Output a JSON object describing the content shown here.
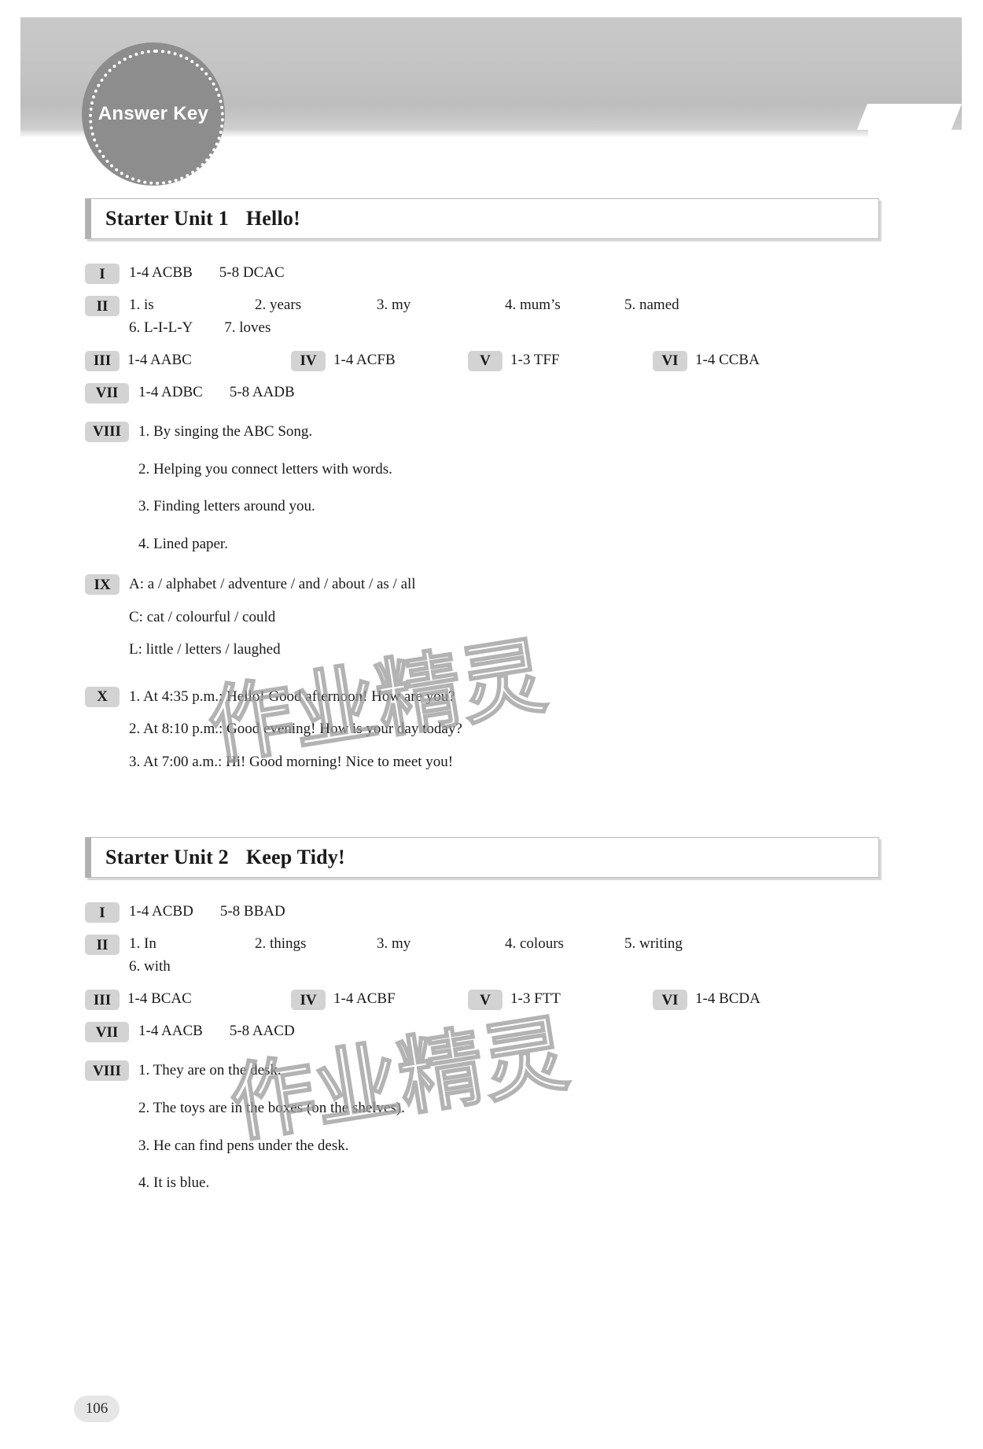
{
  "header": {
    "seal_label": "Answer Key"
  },
  "page_number": "106",
  "watermark": {
    "text": "作业精灵"
  },
  "units": [
    {
      "title_prefix": "Starter Unit 1",
      "title_name": "Hello!",
      "rows": {
        "r1_numeral": "I",
        "r1_a": "1-4 ACBB",
        "r1_b": "5-8 DCAC",
        "r2_numeral": "II",
        "r2_1": "1. is",
        "r2_2": "2. years",
        "r2_3": "3. my",
        "r2_4": "4. mum’s",
        "r2_5": "5. named",
        "r2_6": "6. L-I-L-Y",
        "r2_7": "7. loves",
        "r3_numeral": "III",
        "r3_val": "1-4 AABC",
        "r4_numeral": "IV",
        "r4_val": "1-4 ACFB",
        "r5_numeral": "V",
        "r5_val": "1-3 TFF",
        "r6_numeral": "VI",
        "r6_val": "1-4 CCBA",
        "r7_numeral": "VII",
        "r7_a": "1-4 ADBC",
        "r7_b": "5-8 AADB",
        "r8_numeral": "VIII",
        "r8_1": "1. By singing the ABC Song.",
        "r8_2": "2. Helping you connect letters with words.",
        "r8_3": "3. Finding letters around you.",
        "r8_4": "4. Lined paper.",
        "r9_numeral": "IX",
        "r9_1": "A: a / alphabet / adventure / and / about / as / all",
        "r9_2": "C: cat / colourful / could",
        "r9_3": "L: little / letters / laughed",
        "r10_numeral": "X",
        "r10_1": "1. At 4:35 p.m.: Hello! Good afternoon! How are you?",
        "r10_2": "2. At 8:10 p.m.: Good evening! How is your day today?",
        "r10_3": "3. At 7:00 a.m.: Hi! Good morning! Nice to meet you!"
      }
    },
    {
      "title_prefix": "Starter Unit 2",
      "title_name": "Keep Tidy!",
      "rows": {
        "r1_numeral": "I",
        "r1_a": "1-4 ACBD",
        "r1_b": "5-8 BBAD",
        "r2_numeral": "II",
        "r2_1": "1. In",
        "r2_2": "2. things",
        "r2_3": "3. my",
        "r2_4": "4. colours",
        "r2_5": "5. writing",
        "r2_6": "6. with",
        "r3_numeral": "III",
        "r3_val": "1-4 BCAC",
        "r4_numeral": "IV",
        "r4_val": "1-4 ACBF",
        "r5_numeral": "V",
        "r5_val": "1-3 FTT",
        "r6_numeral": "VI",
        "r6_val": "1-4 BCDA",
        "r7_numeral": "VII",
        "r7_a": "1-4 AACB",
        "r7_b": "5-8 AACD",
        "r8_numeral": "VIII",
        "r8_1": "1. They are on the desk.",
        "r8_2": "2. The toys are in the boxes (on the shelves).",
        "r8_3": "3. He can find pens under the desk.",
        "r8_4": "4. It is blue."
      }
    }
  ]
}
